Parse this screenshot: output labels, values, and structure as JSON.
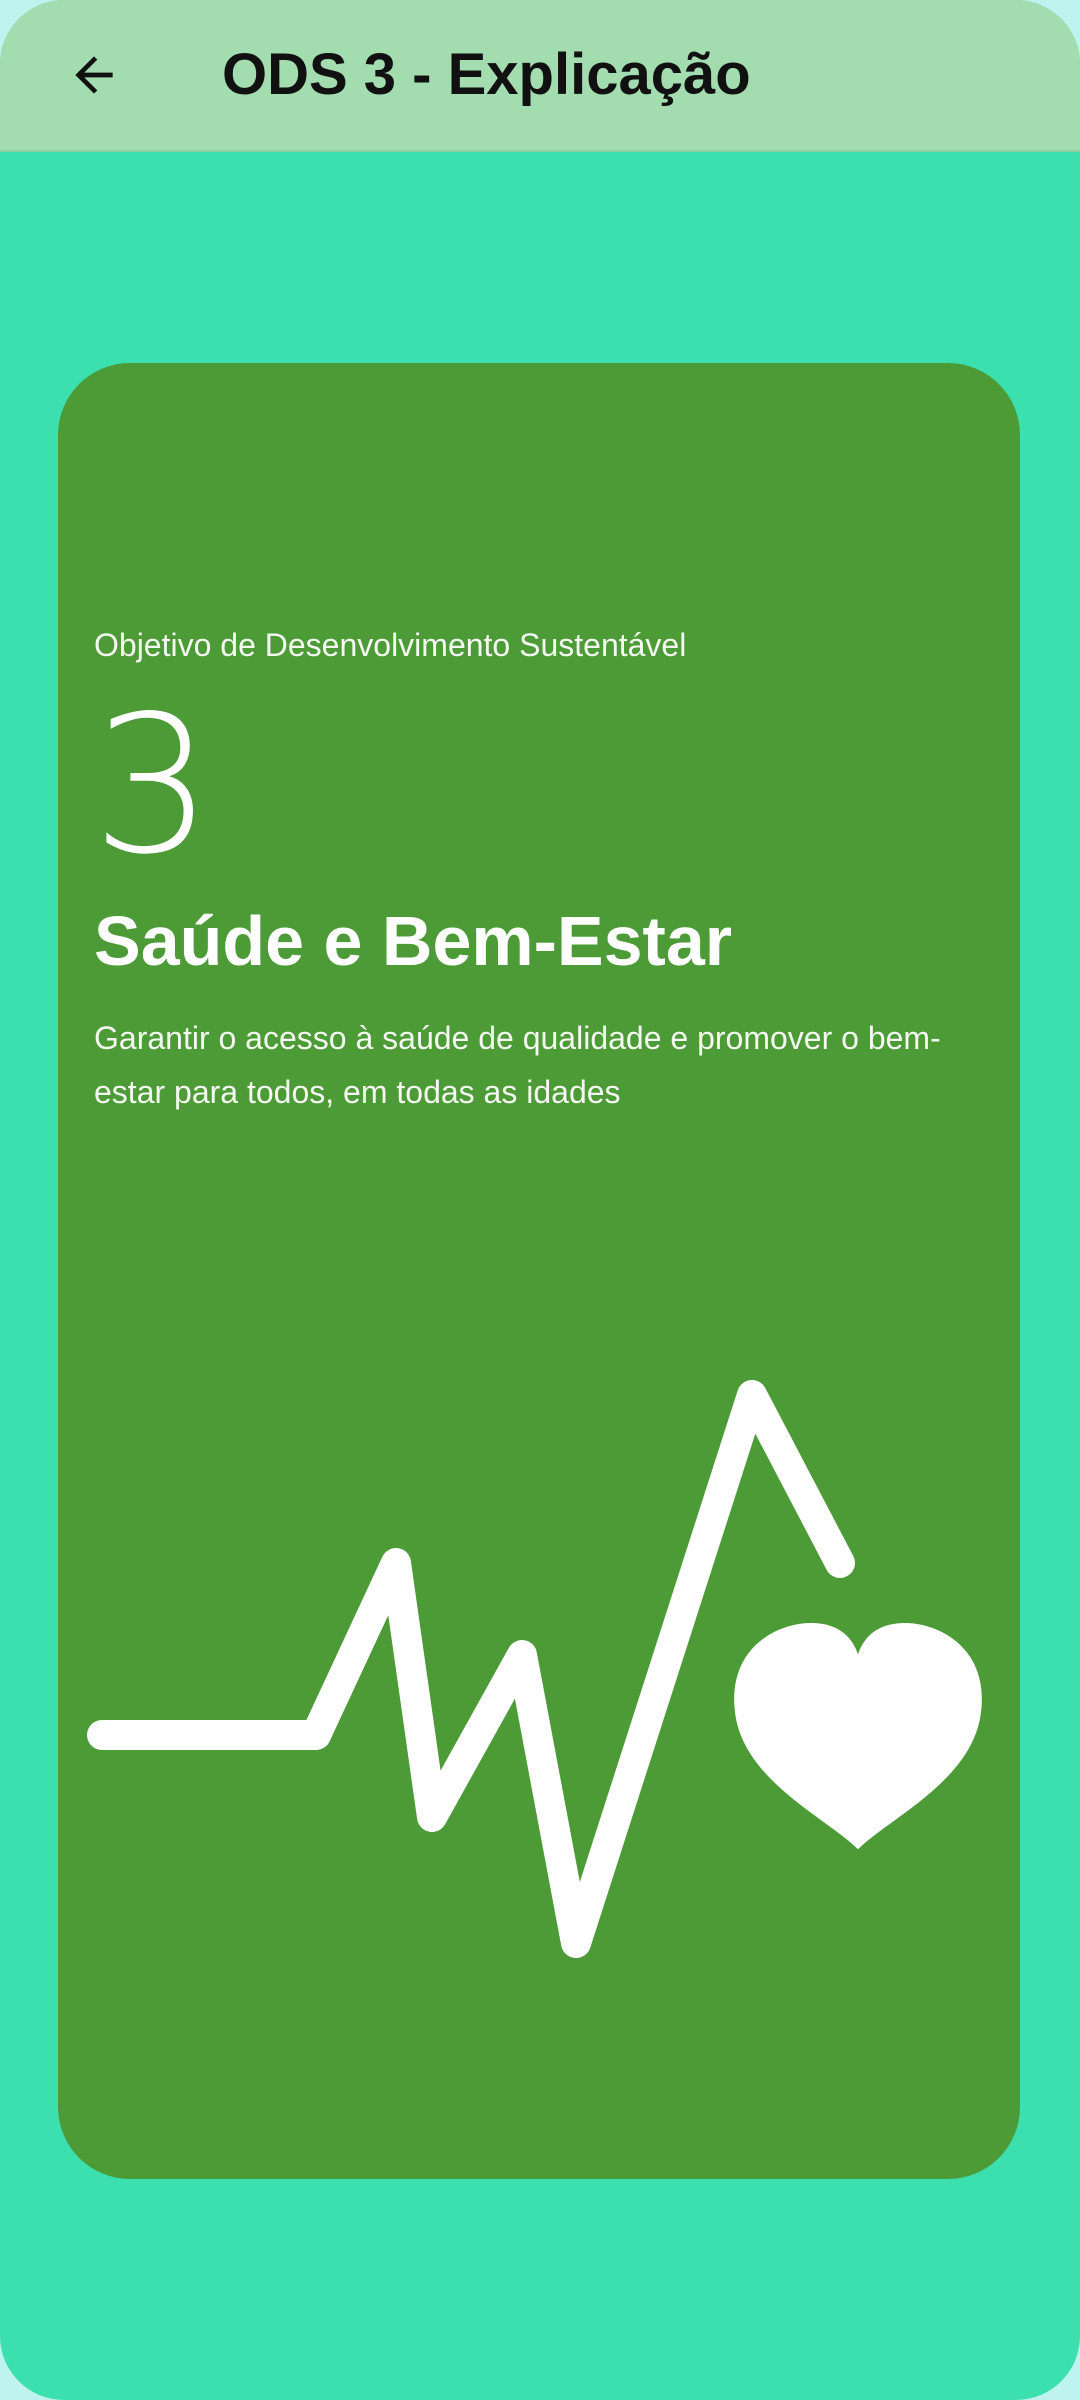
{
  "appbar": {
    "title": "ODS 3 - Explicação",
    "back_icon": "arrow-left-icon"
  },
  "card": {
    "kicker": "Objetivo de Desenvolvimento Sustentável",
    "number": "3",
    "title": "Saúde e Bem-Estar",
    "description": "Garantir o acesso à saúde de qualidade e promover o bem-estar para todos, em todas as idades",
    "illustration": "heartbeat-heart-icon"
  },
  "colors": {
    "background": "#3ce0ae",
    "appbar": "#a3dcaf",
    "card": "#4c9b37",
    "text": "#ffffff"
  }
}
